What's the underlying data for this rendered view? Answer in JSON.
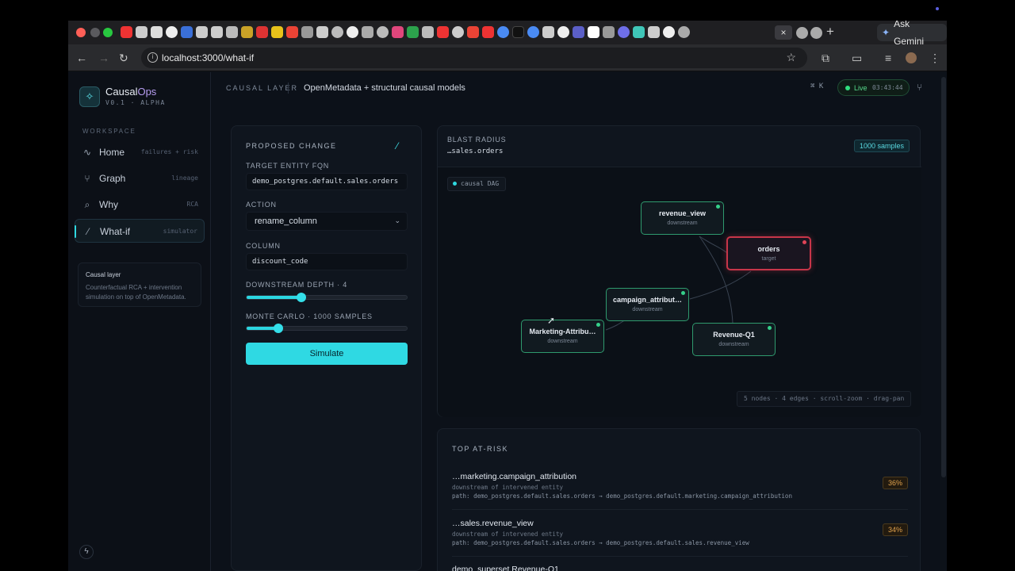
{
  "browser": {
    "url": "localhost:3000/what-if",
    "ask_gemini": "Ask Gemini",
    "tab_close": "×",
    "new_tab": "+"
  },
  "sidebar": {
    "brand_prefix": "Causal",
    "brand_suffix": "Ops",
    "version": "V0.1 · ALPHA",
    "workspace_label": "WORKSPACE",
    "items": [
      {
        "label": "Home",
        "hint": "failures + risk",
        "icon": "activity-icon"
      },
      {
        "label": "Graph",
        "hint": "lineage",
        "icon": "graph-icon"
      },
      {
        "label": "Why",
        "hint": "RCA",
        "icon": "search-icon"
      },
      {
        "label": "What-if",
        "hint": "simulator",
        "icon": "wand-icon"
      }
    ],
    "card_title": "Causal layer",
    "card_text": "Counterfactual RCA + intervention simulation on top of OpenMetadata."
  },
  "header": {
    "section": "CAUSAL LAYER",
    "subtitle": "OpenMetadata + structural causal models",
    "shortcut": "⌘ K",
    "live_label": "Live",
    "live_time": "03:43:44"
  },
  "proposed": {
    "title": "PROPOSED CHANGE",
    "fqn_label": "TARGET ENTITY FQN",
    "fqn_value": "demo_postgres.default.sales.orders",
    "action_label": "ACTION",
    "action_value": "rename_column",
    "column_label": "COLUMN",
    "column_value": "discount_code",
    "depth_label": "DOWNSTREAM DEPTH · 4",
    "depth_fraction": 0.34,
    "mc_label": "MONTE CARLO · 1000 SAMPLES",
    "mc_fraction": 0.2,
    "simulate_label": "Simulate"
  },
  "blast": {
    "title": "BLAST RADIUS",
    "entity": "…sales.orders",
    "samples": "1000 samples",
    "chip": "causal DAG",
    "stats": "5 nodes · 4 edges · scroll-zoom · drag-pan",
    "nodes": [
      {
        "name": "revenue_view",
        "kind": "downstream"
      },
      {
        "name": "orders",
        "kind": "target"
      },
      {
        "name": "campaign_attribut…",
        "kind": "downstream"
      },
      {
        "name": "Marketing-Attribu…",
        "kind": "downstream"
      },
      {
        "name": "Revenue-Q1",
        "kind": "downstream"
      }
    ]
  },
  "risk": {
    "title": "TOP AT-RISK",
    "items": [
      {
        "name": "…marketing.campaign_attribution",
        "sub": "downstream of intervened entity",
        "path": "path: demo_postgres.default.sales.orders → demo_postgres.default.marketing.campaign_attribution",
        "pct": "36%"
      },
      {
        "name": "…sales.revenue_view",
        "sub": "downstream of intervened entity",
        "path": "path: demo_postgres.default.sales.orders → demo_postgres.default.sales.revenue_view",
        "pct": "34%"
      },
      {
        "name": "demo_superset.Revenue-Q1",
        "sub": "",
        "path": "",
        "pct": ""
      }
    ]
  },
  "colors": {
    "accent": "#2fd9e3",
    "target": "#c73549",
    "downstream": "#2f9a6e",
    "live": "#2fe07f",
    "risk": "#e1a24d"
  }
}
